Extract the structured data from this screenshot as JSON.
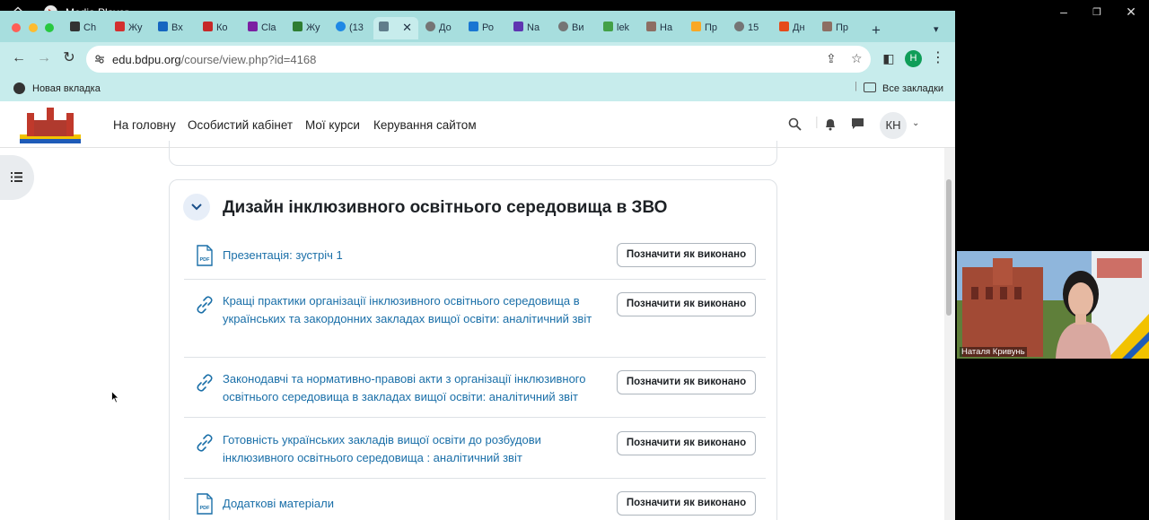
{
  "media_player": {
    "title": "Media Player"
  },
  "tabs": [
    {
      "label": "Ch",
      "fav_color": "#333333"
    },
    {
      "label": "Жу",
      "fav_color": "#d32f2f"
    },
    {
      "label": "Вх",
      "fav_color": "#1565c0"
    },
    {
      "label": "Ко",
      "fav_color": "#c62828"
    },
    {
      "label": "Cla",
      "fav_color": "#7b1fa2"
    },
    {
      "label": "Жу",
      "fav_color": "#2e7d32"
    },
    {
      "label": "(13",
      "fav_color": "#1e88e5"
    },
    {
      "label": "",
      "fav_color": "#607d8b"
    },
    {
      "label": "До",
      "fav_color": "#757575"
    },
    {
      "label": "Ро",
      "fav_color": "#1976d2"
    },
    {
      "label": "Na",
      "fav_color": "#5e35b1"
    },
    {
      "label": "Ви",
      "fav_color": "#757575"
    },
    {
      "label": "lek",
      "fav_color": "#43a047"
    },
    {
      "label": "Ha",
      "fav_color": "#8d6e63"
    },
    {
      "label": "Пр",
      "fav_color": "#f9a825"
    },
    {
      "label": "15",
      "fav_color": "#757575"
    },
    {
      "label": "Дн",
      "fav_color": "#e64a19"
    },
    {
      "label": "Пр",
      "fav_color": "#8d6e63"
    }
  ],
  "address_bar": {
    "domain": "edu.bdpu.org",
    "path": "/course/view.php?id=4168"
  },
  "bookmarks": {
    "new_tab": "Новая вкладка",
    "all": "Все закладки"
  },
  "profile_initial": "Н",
  "site_nav": {
    "links": [
      "На головну",
      "Особистий кабінет",
      "Мої курси",
      "Керування сайтом"
    ],
    "user_initials": "КН"
  },
  "section": {
    "title": "Дизайн інклюзивного освітнього середовища в ЗВО",
    "done_label": "Позначити як виконано",
    "activities": [
      {
        "type": "pdf",
        "title": "Презентація: зустріч 1"
      },
      {
        "type": "link",
        "title": "Кращі практики організації інклюзивного освітнього середовища в українських та закордонних закладах вищої освіти: аналітичний звіт"
      },
      {
        "type": "link",
        "title": "Законодавчі та нормативно-правові акти з організації інклюзивного освітнього середовища в закладах вищої освіти: аналітичний звіт"
      },
      {
        "type": "link",
        "title": "Готовність українських закладів вищої освіти до розбудови інклюзивного освітнього середовища : аналітичний звіт"
      },
      {
        "type": "pdf",
        "title": "Додаткові матеріали"
      }
    ]
  },
  "webcam": {
    "participant_name": "Наталя Кривунь"
  },
  "colors": {
    "accent": "#1a6fa8",
    "chrome": "#a7dede",
    "toolbar": "#c7ecec"
  }
}
